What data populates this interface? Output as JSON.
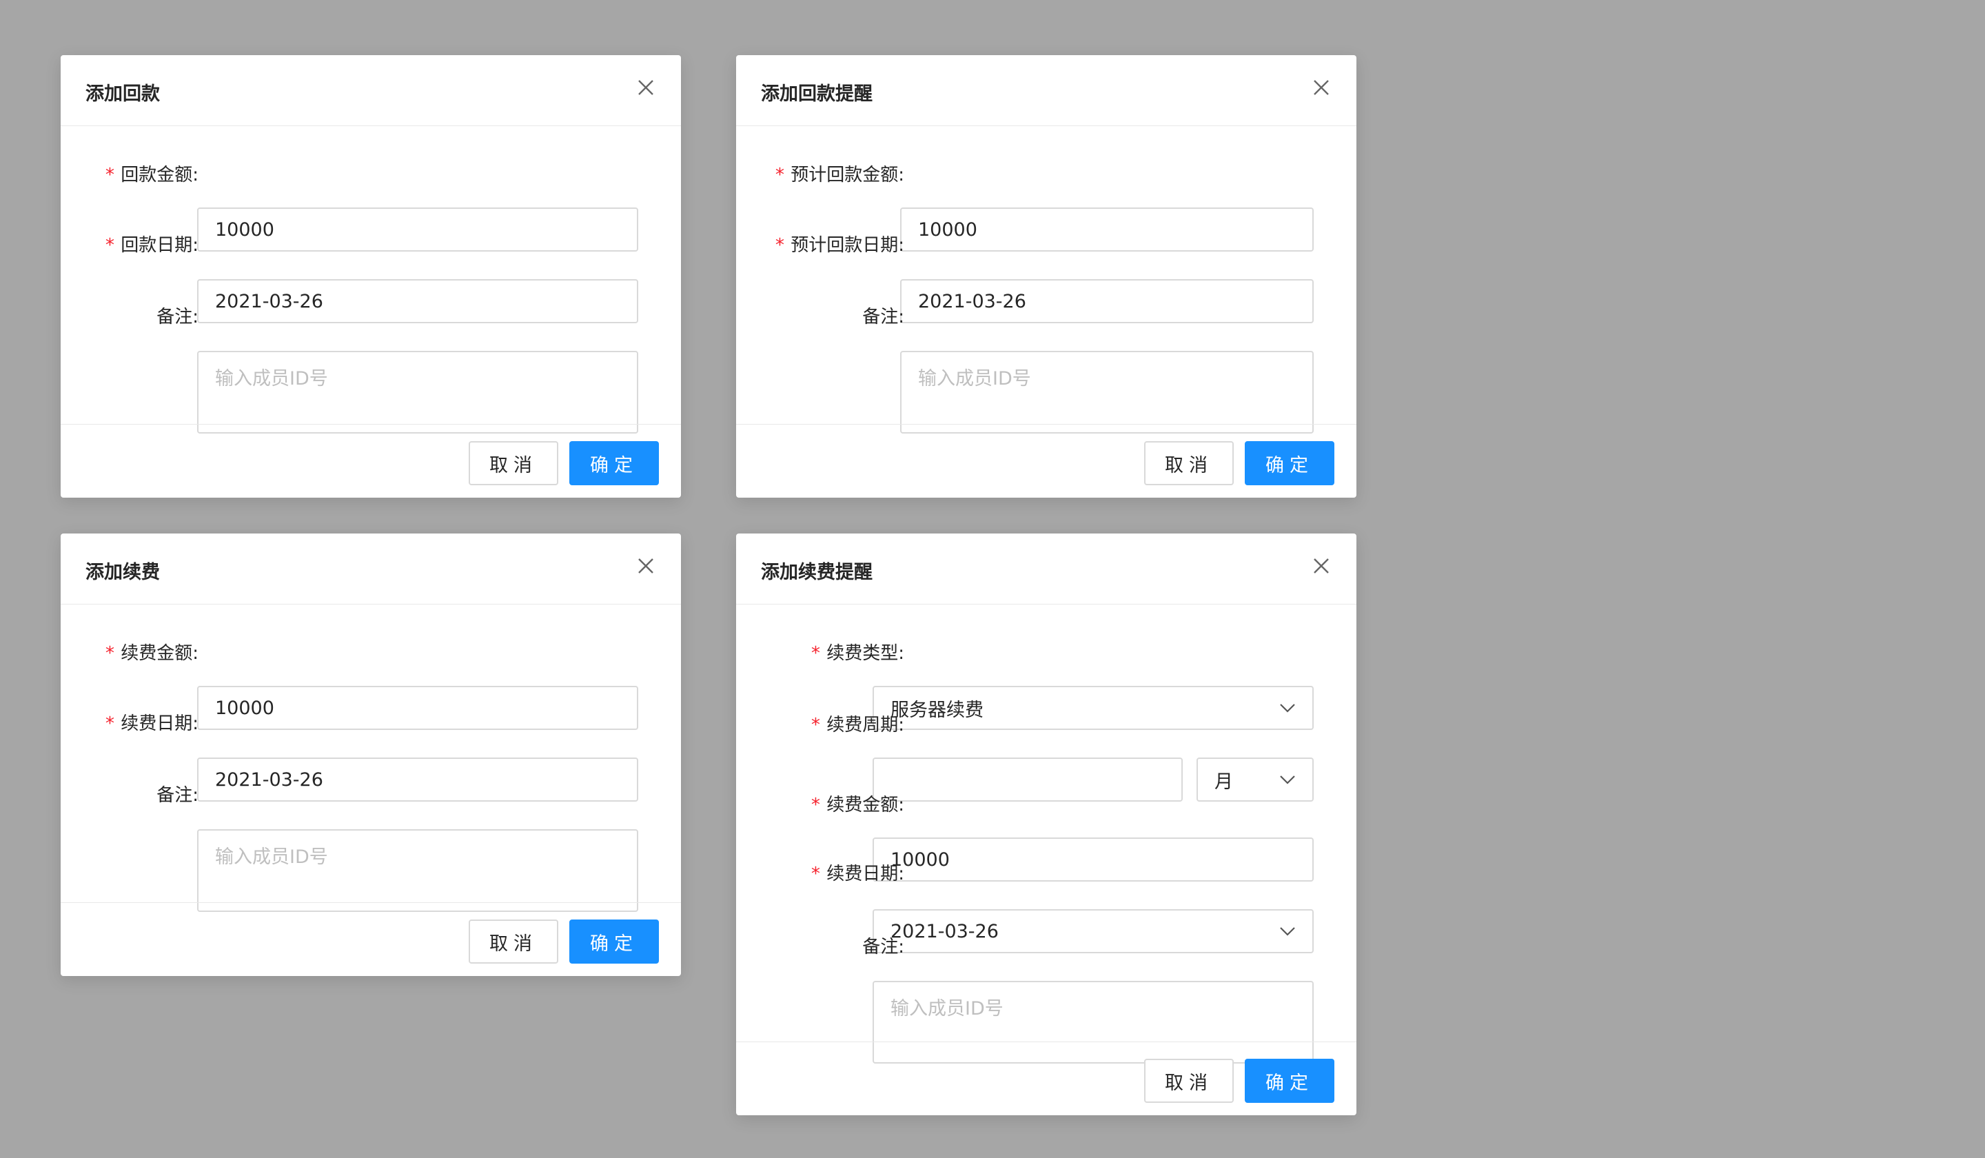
{
  "colors": {
    "background": "#a6a6a6",
    "primary": "#1890ff",
    "required": "#f5222d",
    "placeholder": "#bfbfbf",
    "border": "#d9d9d9"
  },
  "modal1": {
    "title": "添加回款",
    "required_mark": "*",
    "fields": {
      "amount_label": "回款金额:",
      "amount_value": "10000",
      "date_label": "回款日期:",
      "date_value": "2021-03-26",
      "note_label": "备注:",
      "note_placeholder": "输入成员ID号"
    },
    "cancel_label": "取消",
    "ok_label": "确定"
  },
  "modal2": {
    "title": "添加回款提醒",
    "required_mark": "*",
    "fields": {
      "amount_label": "预计回款金额:",
      "amount_value": "10000",
      "date_label": "预计回款日期:",
      "date_value": "2021-03-26",
      "note_label": "备注:",
      "note_placeholder": "输入成员ID号"
    },
    "cancel_label": "取消",
    "ok_label": "确定"
  },
  "modal3": {
    "title": "添加续费",
    "required_mark": "*",
    "fields": {
      "amount_label": "续费金额:",
      "amount_value": "10000",
      "date_label": "续费日期:",
      "date_value": "2021-03-26",
      "note_label": "备注:",
      "note_placeholder": "输入成员ID号"
    },
    "cancel_label": "取消",
    "ok_label": "确定"
  },
  "modal4": {
    "title": "添加续费提醒",
    "required_mark": "*",
    "fields": {
      "type_label": "续费类型:",
      "type_value": "服务器续费",
      "period_label": "续费周期:",
      "period_value": "",
      "period_unit": "月",
      "amount_label": "续费金额:",
      "amount_value": "10000",
      "date_label": "续费日期:",
      "date_value": "2021-03-26",
      "note_label": "备注:",
      "note_placeholder": "输入成员ID号"
    },
    "cancel_label": "取消",
    "ok_label": "确定"
  },
  "icons": {
    "close": "close-icon",
    "dropdown": "chevron-down-icon"
  }
}
